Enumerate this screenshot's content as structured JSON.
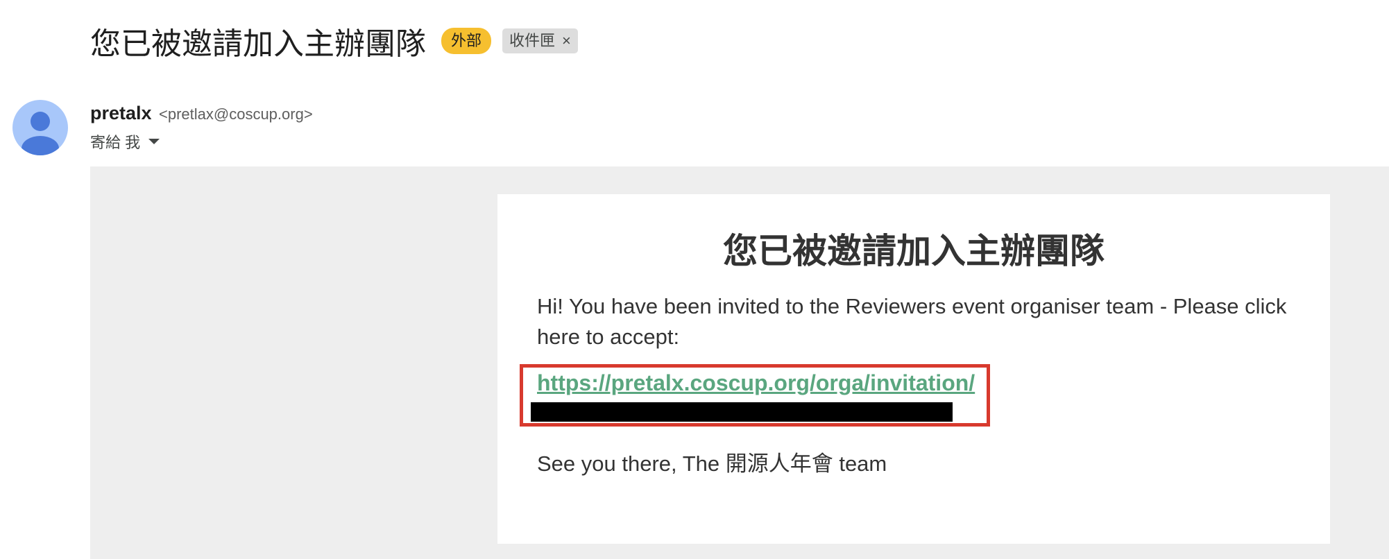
{
  "header": {
    "subject": "您已被邀請加入主辦團隊",
    "external_label": "外部",
    "inbox_label": "收件匣",
    "close_symbol": "×"
  },
  "sender": {
    "name": "pretalx",
    "email": "<pretlax@coscup.org>",
    "to_label": "寄給 我",
    "avatar_color": "#a8c7fa",
    "avatar_figure_color": "#4a79d9"
  },
  "message": {
    "title": "您已被邀請加入主辦團隊",
    "body": "Hi! You have been invited to the Reviewers event organiser team - Please click here to accept:",
    "link": "https://pretalx.coscup.org/orga/invitation/",
    "closing": "See you there, The 開源人年會 team",
    "link_color": "#5aa67f",
    "highlight_color": "#d83a2e"
  }
}
